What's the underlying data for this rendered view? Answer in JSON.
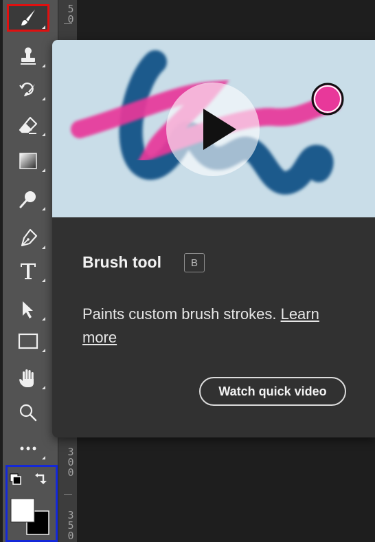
{
  "toolbar": {
    "tools": [
      {
        "name": "brush-tool",
        "icon": "brush-icon",
        "selected": true
      },
      {
        "name": "clone-stamp-tool",
        "icon": "stamp-icon"
      },
      {
        "name": "history-brush-tool",
        "icon": "history-brush-icon"
      },
      {
        "name": "eraser-tool",
        "icon": "eraser-icon"
      },
      {
        "name": "gradient-tool",
        "icon": "gradient-icon"
      },
      {
        "name": "dodge-tool",
        "icon": "dodge-icon"
      },
      {
        "name": "pen-tool",
        "icon": "pen-icon"
      },
      {
        "name": "type-tool",
        "icon": "type-icon"
      },
      {
        "name": "path-selection-tool",
        "icon": "arrow-icon"
      },
      {
        "name": "rectangle-tool",
        "icon": "rectangle-icon"
      },
      {
        "name": "hand-tool",
        "icon": "hand-icon"
      },
      {
        "name": "zoom-tool",
        "icon": "magnifier-icon"
      },
      {
        "name": "more-tools",
        "icon": "ellipsis-icon"
      }
    ],
    "foreground_color": "#ffffff",
    "background_color": "#000000"
  },
  "ruler": {
    "labels": [
      "5 0",
      "3 0 0",
      "3 5 0"
    ]
  },
  "tooltip": {
    "title": "Brush tool",
    "shortcut": "B",
    "description": "Paints custom brush strokes.",
    "learn_more": "Learn more",
    "video_button": "Watch quick video"
  },
  "colors": {
    "selected_outline": "#e01010",
    "color_area_outline": "#1428d8",
    "preview_bg": "#c9dde8",
    "stroke_blue": "#1e5a8c",
    "stroke_pink": "#e8389a"
  }
}
